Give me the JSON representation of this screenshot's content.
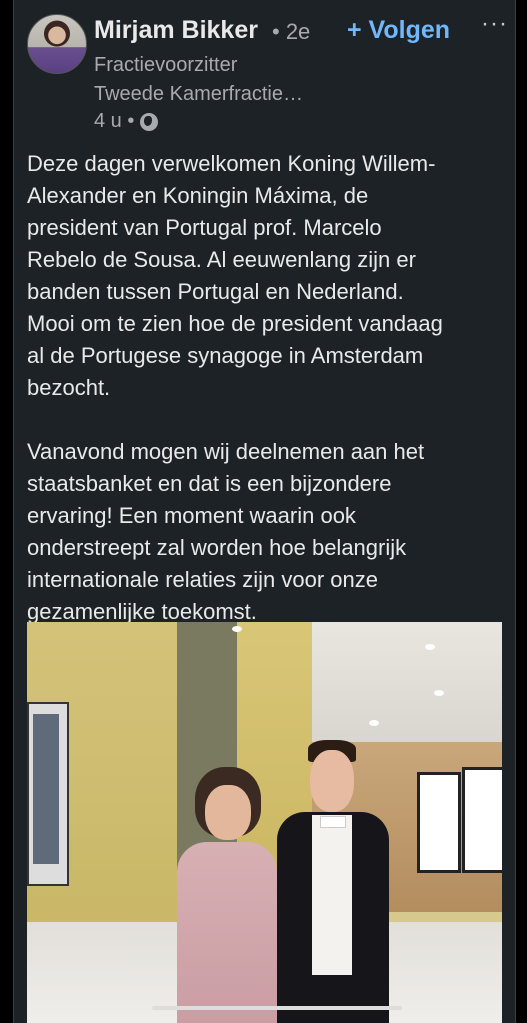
{
  "post": {
    "author": "Mirjam Bikker",
    "degree": "• 2e",
    "follow_label": "+ Volgen",
    "more_label": "···",
    "subtitle_1": "Fractievoorzitter",
    "subtitle_2": "Tweede Kamerfractie…",
    "time": "4 u •",
    "visibility_icon": "globe-icon",
    "body": "Deze dagen verwelkomen Koning Willem-\nAlexander en Koningin Máxima, de\npresident van Portugal prof. Marcelo\nRebelo de Sousa. Al eeuwenlang zijn er\nbanden tussen Portugal en Nederland.\nMooi om te zien hoe de president vandaag\nal de Portugese synagoge in Amsterdam\nbezocht.\n\nVanavond mogen wij deelnemen aan het\nstaatsbanket en dat is een bijzondere\nervaring! Een moment waarin ook\nonderstreept zal worden hoe belangrijk\ninternationale relaties zijn voor onze\ngezamenlijke toekomst."
  },
  "colors": {
    "background": "#1d2226",
    "text": "#e9e9ea",
    "muted": "#a7abaf",
    "accent": "#71b7fb"
  }
}
